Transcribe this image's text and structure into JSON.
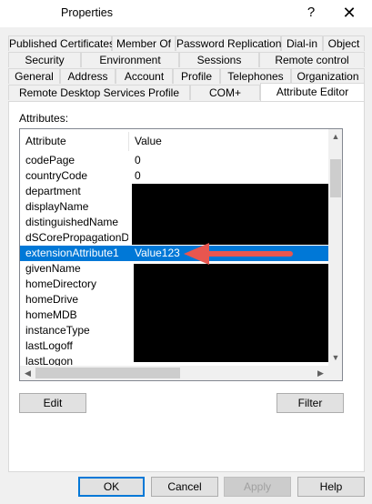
{
  "window": {
    "title": "Properties",
    "help_label": "?",
    "close_label": "✕"
  },
  "tabs": {
    "row1": [
      "Published Certificates",
      "Member Of",
      "Password Replication",
      "Dial-in",
      "Object"
    ],
    "row2": [
      "Security",
      "Environment",
      "Sessions",
      "Remote control"
    ],
    "row3": [
      "General",
      "Address",
      "Account",
      "Profile",
      "Telephones",
      "Organization"
    ],
    "row4": [
      "Remote Desktop Services Profile",
      "COM+",
      "Attribute Editor"
    ],
    "active": "Attribute Editor"
  },
  "attributes_label": "Attributes:",
  "list": {
    "columns": [
      "Attribute",
      "Value"
    ],
    "rows": [
      {
        "attribute": "codePage",
        "value": "0"
      },
      {
        "attribute": "countryCode",
        "value": "0"
      },
      {
        "attribute": "department",
        "value": ""
      },
      {
        "attribute": "displayName",
        "value": ""
      },
      {
        "attribute": "distinguishedName",
        "value": ""
      },
      {
        "attribute": "dSCorePropagationD...",
        "value": ""
      },
      {
        "attribute": "extensionAttribute1",
        "value": "Value123",
        "selected": true
      },
      {
        "attribute": "givenName",
        "value": ""
      },
      {
        "attribute": "homeDirectory",
        "value": ""
      },
      {
        "attribute": "homeDrive",
        "value": ""
      },
      {
        "attribute": "homeMDB",
        "value": ""
      },
      {
        "attribute": "instanceType",
        "value": ""
      },
      {
        "attribute": "lastLogoff",
        "value": ""
      },
      {
        "attribute": "lastLogon",
        "value": ""
      }
    ],
    "selected_color": "#0078d7"
  },
  "buttons": {
    "edit": "Edit",
    "filter": "Filter",
    "ok": "OK",
    "cancel": "Cancel",
    "apply": "Apply",
    "help": "Help"
  },
  "annotation": {
    "arrow_color": "#e8564f"
  }
}
